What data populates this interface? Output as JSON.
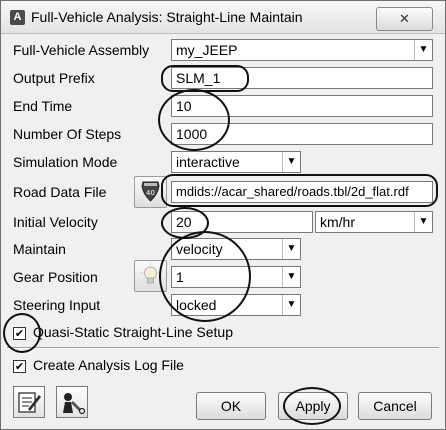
{
  "window": {
    "icon_letter": "A",
    "title": "Full-Vehicle Analysis: Straight-Line Maintain",
    "close_label": "✕"
  },
  "form": {
    "assembly_label": "Full-Vehicle Assembly",
    "assembly_value": "my_JEEP",
    "output_prefix_label": "Output Prefix",
    "output_prefix_value": "SLM_1",
    "end_time_label": "End Time",
    "end_time_value": "10",
    "steps_label": "Number Of Steps",
    "steps_value": "1000",
    "sim_mode_label": "Simulation Mode",
    "sim_mode_value": "interactive",
    "road_label": "Road Data File",
    "road_value": "mdids://acar_shared/roads.tbl/2d_flat.rdf",
    "velocity_label": "Initial Velocity",
    "velocity_value": "20",
    "velocity_unit": "km/hr",
    "maintain_label": "Maintain",
    "maintain_value": "velocity",
    "gear_label": "Gear Position",
    "gear_value": "1",
    "steering_label": "Steering Input",
    "steering_value": "locked"
  },
  "options": {
    "quasi_static_label": "Quasi-Static Straight-Line Setup",
    "quasi_static_checked": true,
    "log_file_label": "Create Analysis Log File",
    "log_file_checked": true,
    "check_mark": "✔"
  },
  "buttons": {
    "ok": "OK",
    "apply": "Apply",
    "cancel": "Cancel"
  },
  "icons": {
    "road_browse": "road-sign-icon",
    "gear_browse": "lightbulb-icon",
    "notes": "notes-icon",
    "tools": "tool-icon"
  }
}
